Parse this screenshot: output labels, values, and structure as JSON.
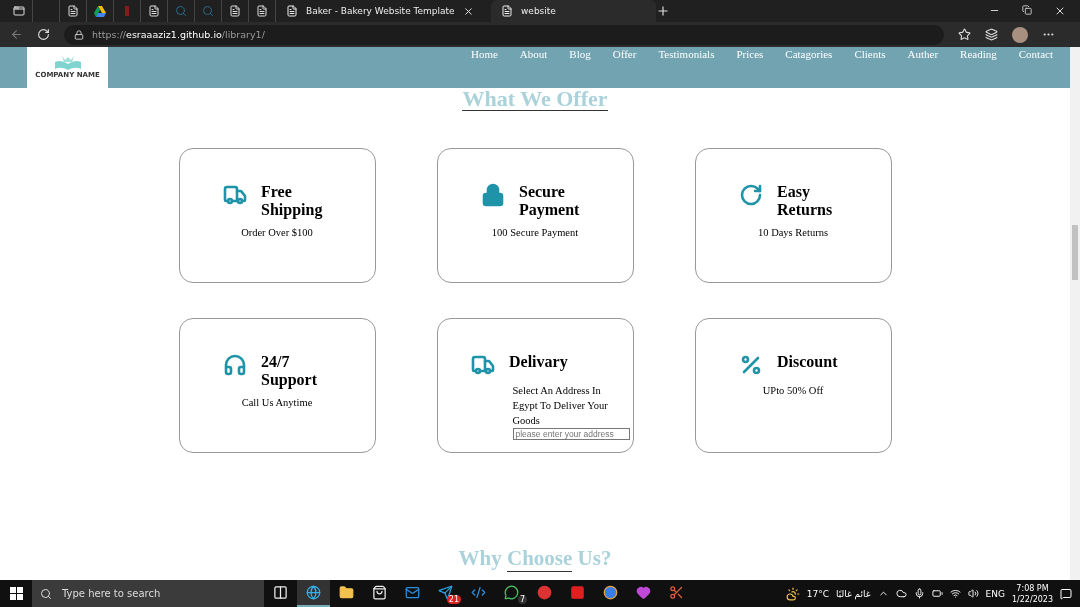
{
  "browser": {
    "tabs": [
      {
        "kind": "window"
      },
      {
        "kind": "blank"
      },
      {
        "kind": "page"
      },
      {
        "kind": "drive"
      },
      {
        "kind": "red"
      },
      {
        "kind": "page"
      },
      {
        "kind": "search"
      },
      {
        "kind": "search"
      },
      {
        "kind": "page"
      },
      {
        "kind": "page"
      },
      {
        "kind": "titled",
        "title": "Baker - Bakery Website Template",
        "selected": false
      },
      {
        "kind": "titled",
        "title": "website",
        "selected": true
      }
    ],
    "address": {
      "scheme": "https://",
      "host": "esraaaziz1.github.io",
      "path": "/library1/"
    }
  },
  "header": {
    "logo_text": "COMPANY NAME",
    "nav": [
      "Home",
      "About",
      "Blog",
      "Offer",
      "Testimonials",
      "Prices",
      "Catagories",
      "Clients",
      "Auther",
      "Reading",
      "Contact"
    ]
  },
  "offer": {
    "title": "What We Offer",
    "features": [
      {
        "kind": "truck",
        "title": "Free Shipping",
        "text": "Order Over $100"
      },
      {
        "kind": "lock",
        "title": "Secure Payment",
        "text": "100 Secure Payment"
      },
      {
        "kind": "returns",
        "title": "Easy Returns",
        "text": "10 Days Returns"
      },
      {
        "kind": "headset",
        "title": "24/7 Support",
        "text": "Call Us Anytime"
      },
      {
        "kind": "truck",
        "title": "Delivary",
        "text": "Select An Address In Egypt To Deliver Your Goods",
        "placeholder": "please enter your address"
      },
      {
        "kind": "percent",
        "title": "Discount",
        "text": "UPto 50% Off"
      }
    ]
  },
  "next_section": {
    "title_start": "Why ",
    "title_underlined": "Choose",
    "title_end": " Us?"
  },
  "taskbar": {
    "search": {
      "placeholder": "Type here to search"
    },
    "apps": [
      {
        "kind": "taskview"
      },
      {
        "kind": "edge",
        "selected": true
      },
      {
        "kind": "files",
        "selected": false
      },
      {
        "kind": "store",
        "selected": false
      },
      {
        "kind": "mail",
        "selected": false
      },
      {
        "kind": "telegram",
        "selected": false,
        "badge": "21"
      },
      {
        "kind": "vscode",
        "selected": false
      },
      {
        "kind": "whatsapp",
        "selected": false,
        "badge": "7"
      },
      {
        "kind": "recorder",
        "selected": false
      },
      {
        "kind": "redapp",
        "selected": false
      },
      {
        "kind": "chrome",
        "selected": false
      },
      {
        "kind": "heart",
        "selected": false
      },
      {
        "kind": "scissors",
        "selected": false
      }
    ],
    "weather": {
      "temp": "17°C",
      "condition": "غائم غالبًا"
    },
    "language": "ENG",
    "time": "7:08 PM",
    "date": "1/22/2023"
  }
}
